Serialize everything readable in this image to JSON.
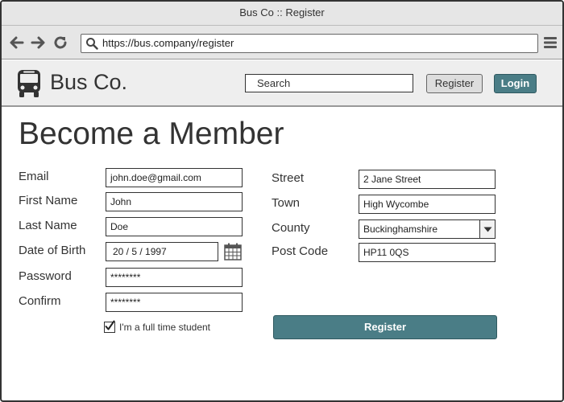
{
  "window": {
    "title": "Bus Co :: Register"
  },
  "browser": {
    "url": "https://bus.company/register"
  },
  "header": {
    "brand": "Bus Co.",
    "search_placeholder": "Search",
    "register_label": "Register",
    "login_label": "Login"
  },
  "page": {
    "title": "Become a Member"
  },
  "form": {
    "left": [
      {
        "label": "Email",
        "value": "john.doe@gmail.com"
      },
      {
        "label": "First Name",
        "value": "John"
      },
      {
        "label": "Last Name",
        "value": "Doe"
      },
      {
        "label": "Date of Birth",
        "value": "20 / 5 / 1997"
      },
      {
        "label": "Password",
        "value": "********"
      },
      {
        "label": "Confirm",
        "value": "********"
      }
    ],
    "right": [
      {
        "label": "Street",
        "value": "2 Jane Street"
      },
      {
        "label": "Town",
        "value": "High Wycombe"
      },
      {
        "label": "County",
        "value": "Buckinghamshire"
      },
      {
        "label": "Post Code",
        "value": "HP11 0QS"
      }
    ],
    "student_label": "I'm a full time student",
    "student_checked": true,
    "submit_label": "Register"
  },
  "colors": {
    "accent": "#4a7d86",
    "header_bg": "#eeeeee"
  }
}
